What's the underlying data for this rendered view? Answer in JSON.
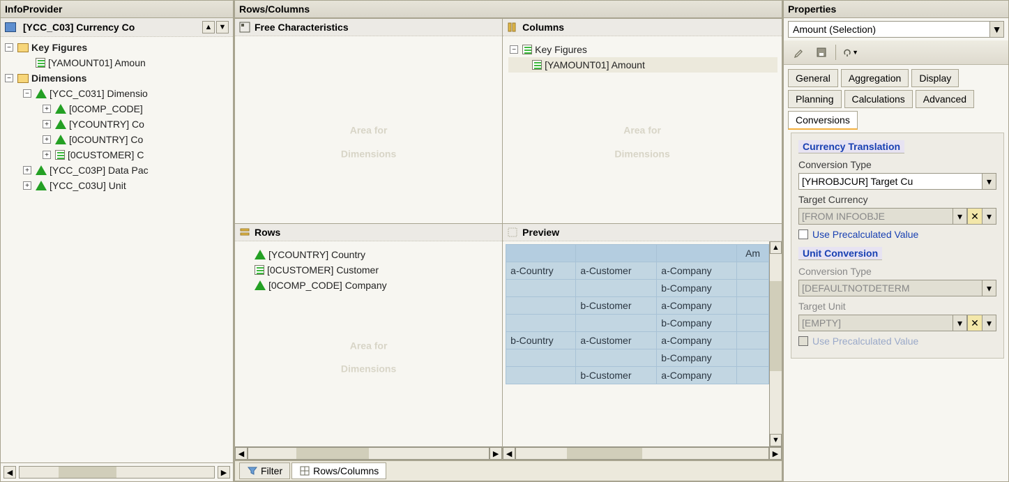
{
  "left": {
    "title": "InfoProvider",
    "root": "[YCC_C03] Currency Co",
    "kf_folder": "Key Figures",
    "kf_item": "[YAMOUNT01] Amoun",
    "dim_folder": "Dimensions",
    "dim1": "[YCC_C031] Dimensio",
    "dim1_children": [
      "[0COMP_CODE]",
      "[YCOUNTRY] Co",
      "[0COUNTRY] Co",
      "[0CUSTOMER] C"
    ],
    "dimp": "[YCC_C03P] Data Pac",
    "dimu": "[YCC_C03U] Unit"
  },
  "mid": {
    "title": "Rows/Columns",
    "free_title": "Free Characteristics",
    "cols_title": "Columns",
    "cols_kf": "Key Figures",
    "cols_item": "[YAMOUNT01] Amount",
    "rows_title": "Rows",
    "rows_items": [
      "[YCOUNTRY] Country",
      "[0CUSTOMER] Customer",
      "[0COMP_CODE] Company"
    ],
    "preview_title": "Preview",
    "preview_col": "Am",
    "preview_rows": [
      [
        "a-Country",
        "a-Customer",
        "a-Company"
      ],
      [
        "",
        "",
        "b-Company"
      ],
      [
        "",
        "b-Customer",
        "a-Company"
      ],
      [
        "",
        "",
        "b-Company"
      ],
      [
        "b-Country",
        "a-Customer",
        "a-Company"
      ],
      [
        "",
        "",
        "b-Company"
      ],
      [
        "",
        "b-Customer",
        "a-Company"
      ]
    ],
    "watermark": "Area for\nDimensions",
    "tabs": [
      "Filter",
      "Rows/Columns"
    ]
  },
  "right": {
    "title": "Properties",
    "selection": "Amount (Selection)",
    "tabs": [
      "General",
      "Aggregation",
      "Display",
      "Planning",
      "Calculations",
      "Advanced",
      "Conversions"
    ],
    "sect1": "Currency Translation",
    "convtype_lbl": "Conversion Type",
    "convtype_val": "[YHROBJCUR] Target Cu",
    "tcurr_lbl": "Target Currency",
    "tcurr_val": "[FROM INFOOBJE",
    "precalc1": "Use Precalculated Value",
    "sect2": "Unit Conversion",
    "convtype2_lbl": "Conversion Type",
    "convtype2_val": "[DEFAULTNOTDETERM",
    "tunit_lbl": "Target Unit",
    "tunit_val": "[EMPTY]",
    "precalc2": "Use Precalculated Value"
  }
}
